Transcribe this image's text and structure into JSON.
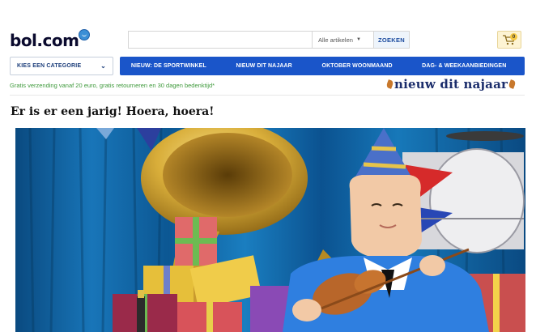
{
  "header": {
    "logo_text": "bol.com",
    "search": {
      "placeholder": "",
      "scope": "Alle artikelen",
      "button": "ZOEKEN"
    },
    "cart": {
      "count": "0"
    }
  },
  "nav": {
    "category_button": "KIES EEN CATEGORIE",
    "items": [
      {
        "label": "NIEUW: DE SPORTWINKEL"
      },
      {
        "label": "NIEUW DIT NAJAAR"
      },
      {
        "label": "OKTOBER WOONMAAND"
      },
      {
        "label": "DAG- & WEEKAANBIEDINGEN"
      }
    ]
  },
  "promo": {
    "text": "Gratis verzending vanaf 20 euro, gratis retourneren en 30 dagen bedenktijd*",
    "banner_text": "nieuw dit najaar"
  },
  "main": {
    "headline": "Er is er een jarig! Hoera, hoera!",
    "hero": {
      "description": "animated party scene with tuba, presents and drum"
    }
  },
  "colors": {
    "nav_blue": "#1a55c9",
    "promo_green": "#3f9a3c",
    "search_button_text": "#1b4a9e",
    "curtain_blue": "#0d5a94"
  }
}
